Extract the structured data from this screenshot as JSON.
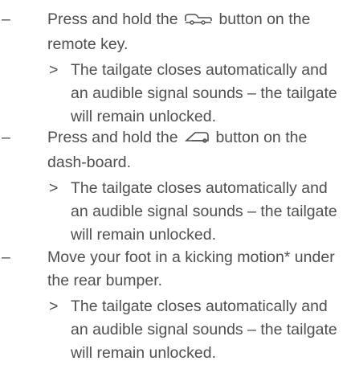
{
  "steps": [
    {
      "dash": "–",
      "before_icon": "Press and hold the ",
      "icon": "tailgate-key-icon",
      "after_icon": " button on the remote key.",
      "result_marker": ">",
      "result": "The tailgate closes automatically and an audible signal sounds – the tailgate will remain unlocked."
    },
    {
      "dash": "–",
      "before_icon": "Press and hold the ",
      "icon": "tailgate-dashboard-icon",
      "after_icon": " button on the dash-board.",
      "result_marker": ">",
      "result": "The tailgate closes automatically and an audible signal sounds – the tailgate will remain unlocked."
    },
    {
      "dash": "–",
      "text": "Move your foot in a kicking motion* under the rear bumper.",
      "result_marker": ">",
      "result": "The tailgate closes automatically and an audible signal sounds – the tailgate will remain unlocked."
    }
  ],
  "colors": {
    "text": "#4f4f4f",
    "background": "#ffffff"
  }
}
